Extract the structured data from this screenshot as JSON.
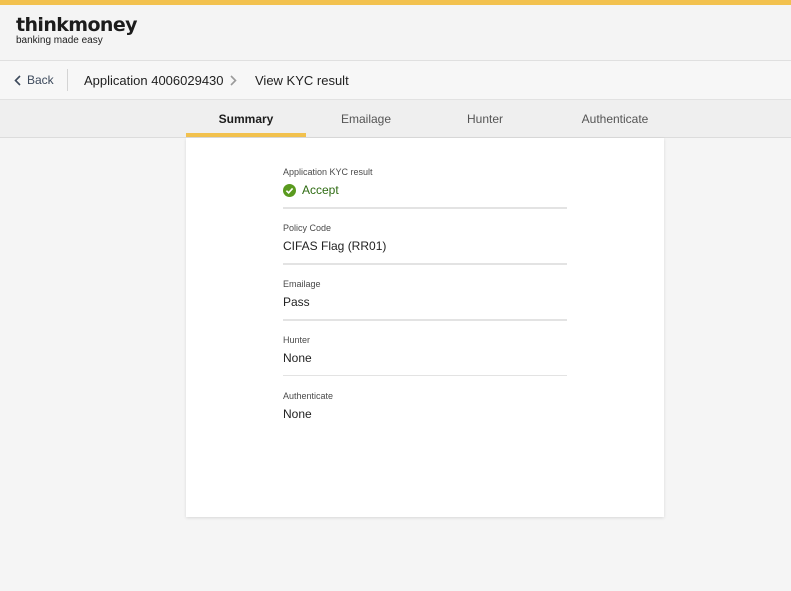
{
  "brand": {
    "name": "thinkmoney",
    "tagline": "banking made easy",
    "accent_color": "#f2c14e"
  },
  "breadcrumb": {
    "back_label": "Back",
    "application": "Application 4006029430",
    "current": "View KYC result"
  },
  "tabs": [
    {
      "label": "Summary",
      "active": true
    },
    {
      "label": "Emailage",
      "active": false
    },
    {
      "label": "Hunter",
      "active": false
    },
    {
      "label": "Authenticate",
      "active": false
    }
  ],
  "summary": {
    "fields": [
      {
        "label": "Application KYC result",
        "value": "Accept",
        "icon": "check-circle-icon",
        "status_color": "#5a9a1f"
      },
      {
        "label": "Policy Code",
        "value": "CIFAS Flag (RR01)"
      },
      {
        "label": "Emailage",
        "value": "Pass"
      },
      {
        "label": "Hunter",
        "value": "None"
      },
      {
        "label": "Authenticate",
        "value": "None"
      }
    ]
  }
}
